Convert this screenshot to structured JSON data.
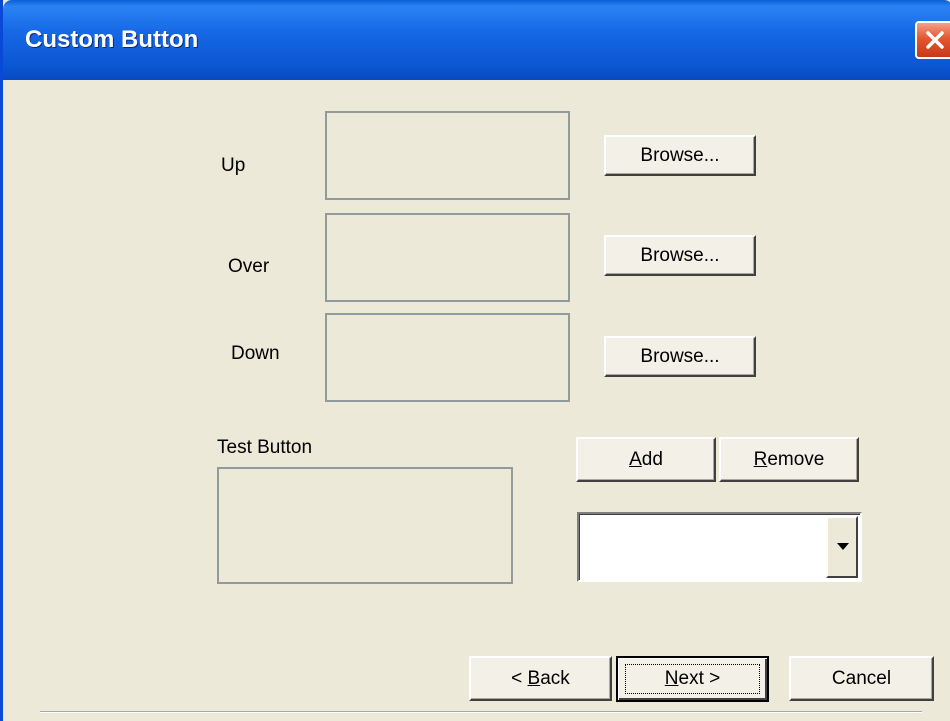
{
  "window": {
    "title": "Custom Button",
    "close_icon": "close-icon"
  },
  "states": [
    {
      "label": "Up",
      "browse_label": "Browse..."
    },
    {
      "label": "Over",
      "browse_label": "Browse..."
    },
    {
      "label": "Down",
      "browse_label": "Browse..."
    }
  ],
  "test_button": {
    "label": "Test Button"
  },
  "actions": {
    "add_prefix": "",
    "add_mnemonic": "A",
    "add_suffix": "dd",
    "remove_prefix": "",
    "remove_mnemonic": "R",
    "remove_suffix": "emove"
  },
  "combo": {
    "value": "",
    "arrow_icon": "chevron-down-icon"
  },
  "footer": {
    "back_prefix": "< ",
    "back_mnemonic": "B",
    "back_suffix": "ack",
    "next_prefix": "",
    "next_mnemonic": "N",
    "next_suffix": "ext >",
    "cancel_label": "Cancel"
  },
  "colors": {
    "titlebar": "#0a55d2",
    "dialog_bg": "#ece9d8",
    "close_button": "#e4572f"
  }
}
